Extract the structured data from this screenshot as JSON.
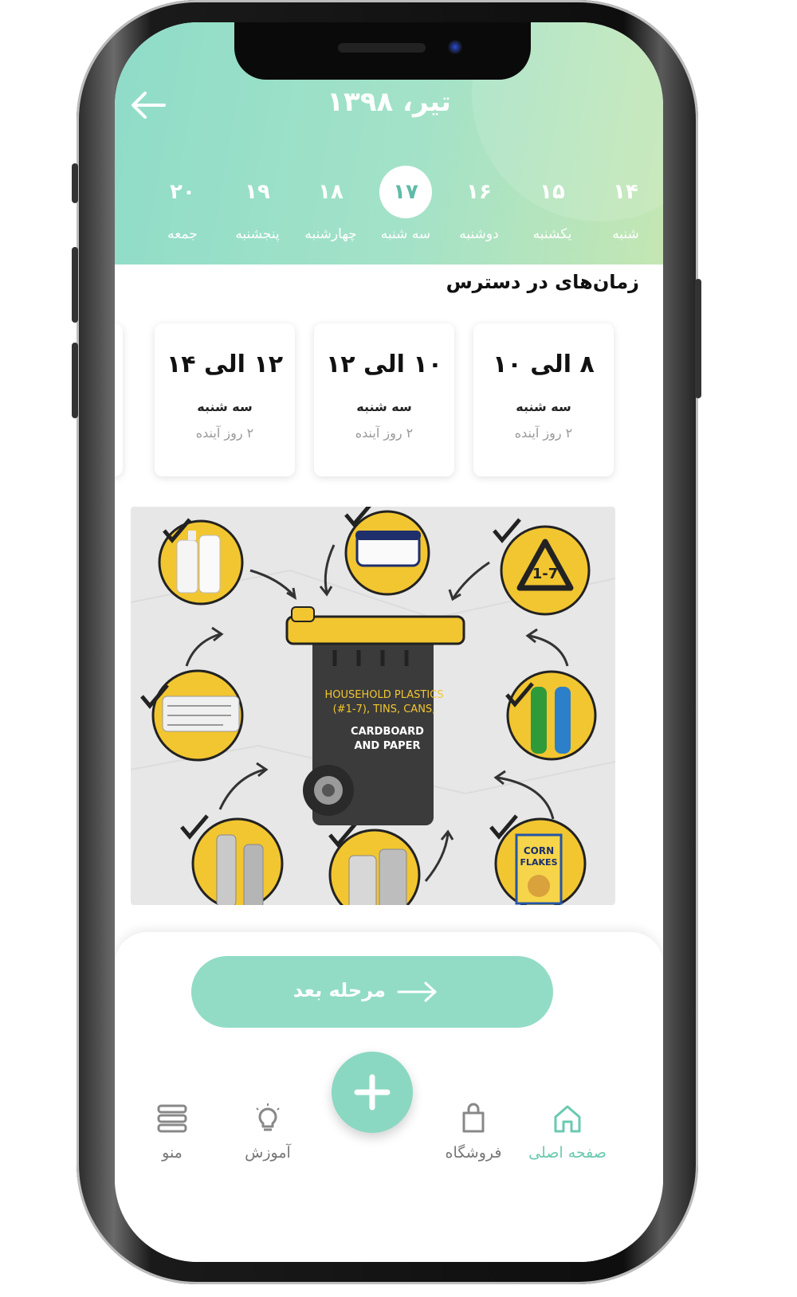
{
  "header": {
    "back_icon": "arrow-left-icon",
    "month_title": "تیر، ۱۳۹۸"
  },
  "days": [
    {
      "num": "۱۴",
      "name": "شنبه",
      "active": false
    },
    {
      "num": "۱۵",
      "name": "یکشنبه",
      "active": false
    },
    {
      "num": "۱۶",
      "name": "دوشنبه",
      "active": false
    },
    {
      "num": "۱۷",
      "name": "سه شنبه",
      "active": true
    },
    {
      "num": "۱۸",
      "name": "چهارشنبه",
      "active": false
    },
    {
      "num": "۱۹",
      "name": "پنجشنبه",
      "active": false
    },
    {
      "num": "۲۰",
      "name": "جمعه",
      "active": false
    }
  ],
  "available": {
    "title": "زمان‌های در دسترس",
    "slots": [
      {
        "time": "۸ الی ۱۰",
        "day": "سه شنبه",
        "relative": "۲ روز آینده"
      },
      {
        "time": "۱۰ الی ۱۲",
        "day": "سه شنبه",
        "relative": "۲ روز آینده"
      },
      {
        "time": "۱۲ الی ۱۴",
        "day": "سه شنبه",
        "relative": "۲ روز آینده"
      }
    ]
  },
  "illustration": {
    "bin_text_line1": "HOUSEHOLD PLASTICS",
    "bin_text_line2": "(#1-7), TINS, CANS,",
    "bin_text_line3": "CARDBOARD",
    "bin_text_line4": "AND PAPER",
    "recycle_code": "1-7",
    "cereal_line1": "CORN",
    "cereal_line2": "FLAKES",
    "colors": {
      "yellow": "#f2c630",
      "bin": "#3b3b3b",
      "paper_bg": "#e7e7e7"
    }
  },
  "next_button": {
    "label": "مرحله بعد",
    "icon": "arrow-right-icon"
  },
  "fab": {
    "icon": "plus-icon"
  },
  "tabs": [
    {
      "label": "صفحه اصلی",
      "icon": "home-icon",
      "active": true
    },
    {
      "label": "فروشگاه",
      "icon": "shopping-bag-icon",
      "active": false
    },
    {
      "label": "آموزش",
      "icon": "lightbulb-icon",
      "active": false
    },
    {
      "label": "منو",
      "icon": "menu-icon",
      "active": false
    }
  ],
  "theme": {
    "accent": "#8fdcc8",
    "accent_dark": "#5fbba8",
    "button": "#92dcc5"
  }
}
